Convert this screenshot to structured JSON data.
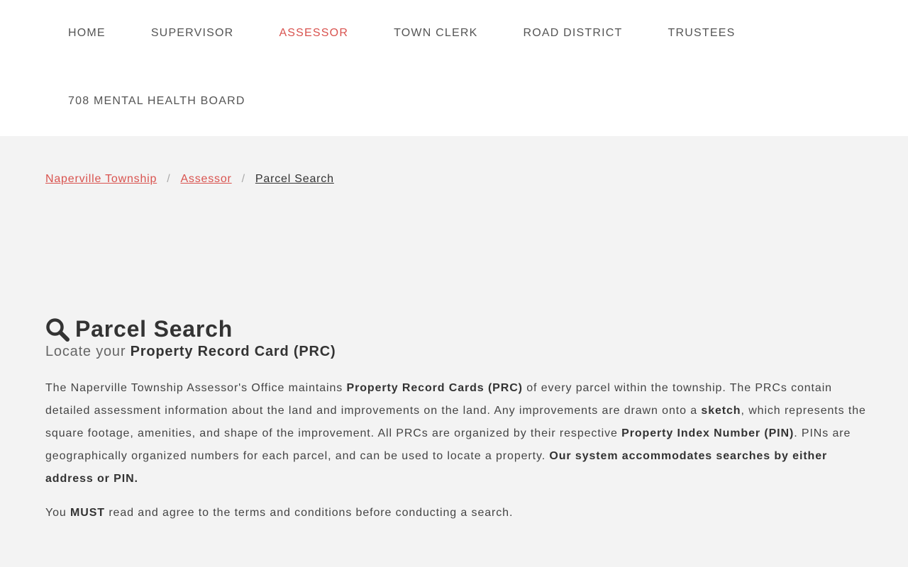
{
  "nav": {
    "items": [
      {
        "label": "HOME"
      },
      {
        "label": "SUPERVISOR"
      },
      {
        "label": "ASSESSOR"
      },
      {
        "label": "TOWN CLERK"
      },
      {
        "label": "ROAD DISTRICT"
      },
      {
        "label": "TRUSTEES"
      },
      {
        "label": "708 MENTAL HEALTH BOARD"
      }
    ],
    "active_color": "#d9534f"
  },
  "breadcrumb": {
    "items": [
      {
        "label": "Naperville Township"
      },
      {
        "label": "Assessor"
      },
      {
        "label": "Parcel Search"
      }
    ],
    "separator": "/"
  },
  "main": {
    "title_icon": "search-icon",
    "title": "Parcel Search",
    "subtitle_prefix": "Locate your ",
    "subtitle_bold": "Property Record Card (PRC)",
    "paragraph1": [
      {
        "text": "The Naperville Township Assessor's Office maintains ",
        "bold": false
      },
      {
        "text": "Property Record Cards (PRC)",
        "bold": true
      },
      {
        "text": " of every parcel within the township. The PRCs contain detailed assessment information about the land and improvements on the land. Any improvements are drawn onto a ",
        "bold": false
      },
      {
        "text": "sketch",
        "bold": true
      },
      {
        "text": ", which represents the square footage, amenities, and shape of the improvement. All PRCs are organized by their respective ",
        "bold": false
      },
      {
        "text": "Property Index Number (PIN)",
        "bold": true
      },
      {
        "text": ". PINs are geographically organized numbers for each parcel, and can be used to locate a property. ",
        "bold": false
      },
      {
        "text": "Our system accommodates searches by either address or PIN.",
        "bold": true
      }
    ],
    "paragraph2": [
      {
        "text": "You ",
        "bold": false
      },
      {
        "text": "MUST",
        "bold": true
      },
      {
        "text": " read and agree to the terms and conditions before conducting a search.",
        "bold": false
      }
    ]
  }
}
